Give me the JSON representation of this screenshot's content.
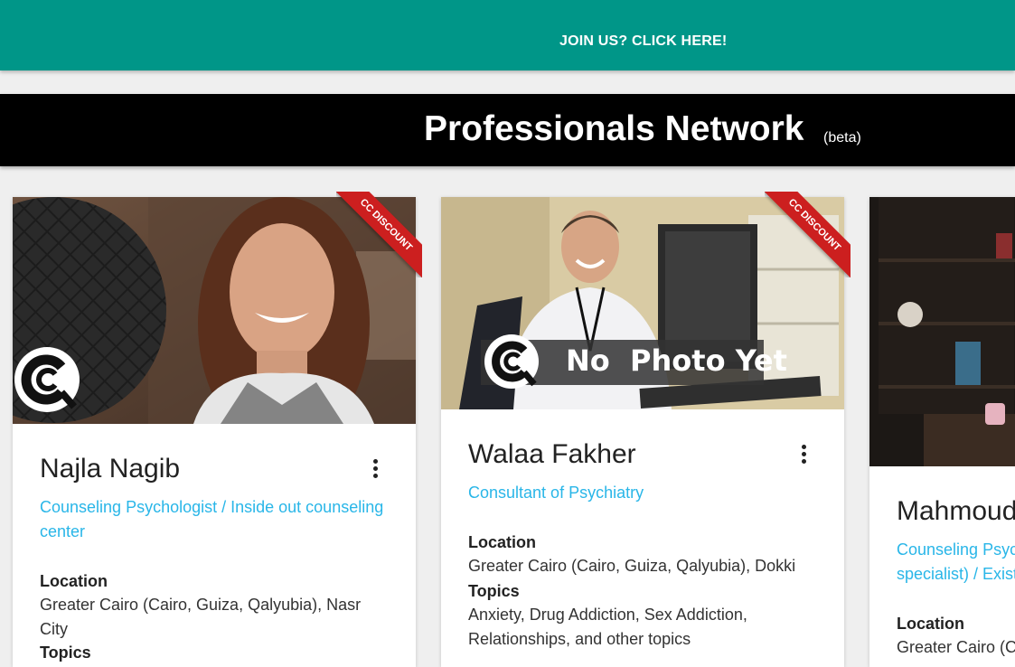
{
  "header": {
    "join_link": "JOIN US? CLICK HERE!"
  },
  "banner": {
    "title": "Professionals Network",
    "badge": "(beta)"
  },
  "colors": {
    "accent_teal": "#009688",
    "role_blue": "#29b6e8",
    "ribbon_red": "#cc1f1f"
  },
  "cards": [
    {
      "name": "Najla Nagib",
      "role": "Counseling Psychologist / Inside out counseling center",
      "ribbon": "CC DISCOUNT",
      "location_label": "Location",
      "location": "Greater Cairo (Cairo, Guiza, Qalyubia), Nasr City",
      "topics_label": "Topics"
    },
    {
      "name": "Walaa Fakher",
      "role": "Consultant of Psychiatry",
      "ribbon": "CC DISCOUNT",
      "photo_overlay": "No  Photo Yet",
      "location_label": "Location",
      "location": "Greater Cairo (Cairo, Guiza, Qalyubia), Dokki",
      "topics_label": "Topics",
      "topics": "Anxiety, Drug Addiction, Sex Addiction, Relationships, and other topics"
    },
    {
      "name": "Mahmoud",
      "role": "Counseling Psyc specialist) / Exist",
      "location_label": "Location",
      "location": "Greater Cairo (C"
    }
  ]
}
